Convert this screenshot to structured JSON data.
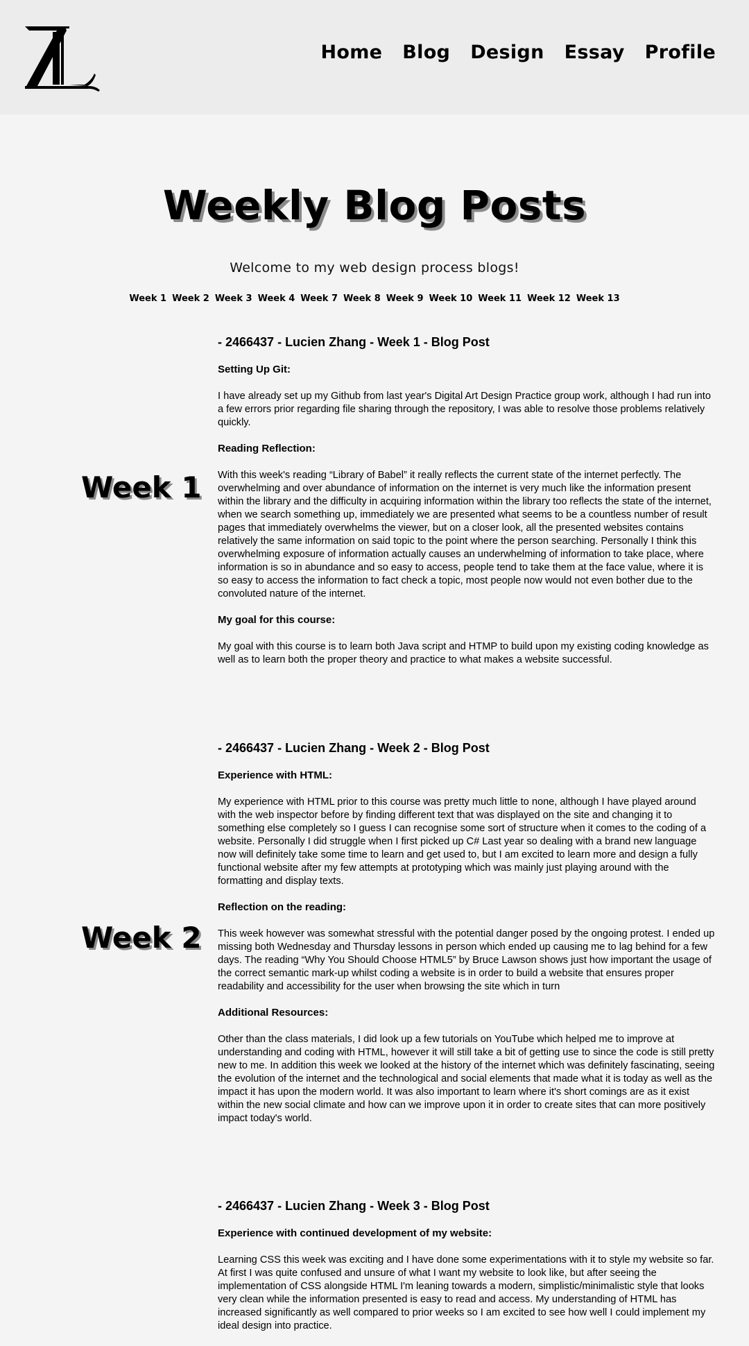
{
  "nav": {
    "items": [
      "Home",
      "Blog",
      "Design",
      "Essay",
      "Profile"
    ]
  },
  "hero": {
    "title": "Weekly Blog Posts",
    "welcome": "Welcome to my web design process blogs!"
  },
  "week_nav": [
    "Week 1",
    "Week 2",
    "Week 3",
    "Week 4",
    "Week 7",
    "Week 8",
    "Week 9",
    "Week 10",
    "Week 11",
    "Week 12",
    "Week 13"
  ],
  "posts": [
    {
      "week_label": "Week 1",
      "title": "- 2466437 - Lucien Zhang - Week 1 - Blog Post",
      "sections": [
        {
          "heading": "Setting Up Git:",
          "text": "I have already set up my Github from last year's Digital Art Design Practice group work, although I had run into a few errors prior regarding file sharing through the repository, I was able to resolve those problems relatively quickly."
        },
        {
          "heading": "Reading Reflection:",
          "text": "With this week's reading “Library of Babel” it really reflects the current state of the internet perfectly. The overwhelming and over abundance of information on the internet is very much like the information present within the library and the difficulty in acquiring information within the library too reflects the state of the internet, when we search something up, immediately we are presented what seems to be a countless number of result pages that immediately overwhelms the viewer, but on a closer look, all the presented websites contains relatively the same information on said topic to the point where the person searching. Personally I think this overwhelming exposure of information actually causes an underwhelming of information to take place, where information is so in abundance and so easy to access, people tend to take them at the face value, where it is so easy to access the information to fact check a topic, most people now would not even bother due to the convoluted nature of the internet."
        },
        {
          "heading": "My goal for this course:",
          "text": "My goal with this course is to learn both Java script and HTMP to build upon my existing coding knowledge as well as to learn both the proper theory and practice to what makes a website successful."
        }
      ]
    },
    {
      "week_label": "Week 2",
      "title": "- 2466437 - Lucien Zhang - Week 2 - Blog Post",
      "sections": [
        {
          "heading": "Experience with HTML:",
          "text": "My experience with HTML prior to this course was pretty much little to none, although I have played around with the web inspector before by finding different text that was displayed on the site and changing it to something else completely so I guess I can recognise some sort of structure when it comes to the coding of a website. Personally I did struggle when I first picked up C# Last year so dealing with a brand new language now will definitely take some time to learn and get used to, but I am excited to learn more and design a fully functional website after my few attempts at prototyping which was mainly just playing around with the formatting and display texts."
        },
        {
          "heading": "Reflection on the reading:",
          "text": "This week however was somewhat stressful with the potential danger posed by the ongoing protest. I ended up missing both Wednesday and Thursday lessons in person which ended up causing me to lag behind for a few days. The reading “Why You Should Choose HTML5” by Bruce Lawson shows just how important the usage of the correct semantic mark-up whilst coding a website is in order to build a website that ensures proper readability and accessibility for the user when browsing the site which in turn"
        },
        {
          "heading": "Additional Resources:",
          "text": "Other than the class materials, I did look up a few tutorials on YouTube which helped me to improve at understanding and coding with HTML, however it will still take a bit of getting use to since the code is still pretty new to me. In addition this week we looked at the history of the internet which was definitely fascinating, seeing the evolution of the internet and the technological and social elements that made what it is today as well as the impact it has upon the modern world. It was also important to learn where it's short comings are as it exist within the new social climate and how can we improve upon it in order to create sites that can more positively impact today's world."
        }
      ]
    },
    {
      "week_label": "",
      "title": "- 2466437 - Lucien Zhang - Week 3 - Blog Post",
      "sections": [
        {
          "heading": "Experience with continued development of my website:",
          "text": "Learning CSS this week was exciting and I have done some experimentations with it to style my website so far. At first I was quite confused and unsure of what I want my website to look like, but after seeing the implementation of CSS alongside HTML I'm leaning towards a modern, simplistic/minimalistic style that looks very clean while the information presented is easy to read and access. My understanding of HTML has increased significantly as well compared to prior weeks so I am excited to see how well I could implement my ideal design into practice."
        }
      ]
    }
  ]
}
